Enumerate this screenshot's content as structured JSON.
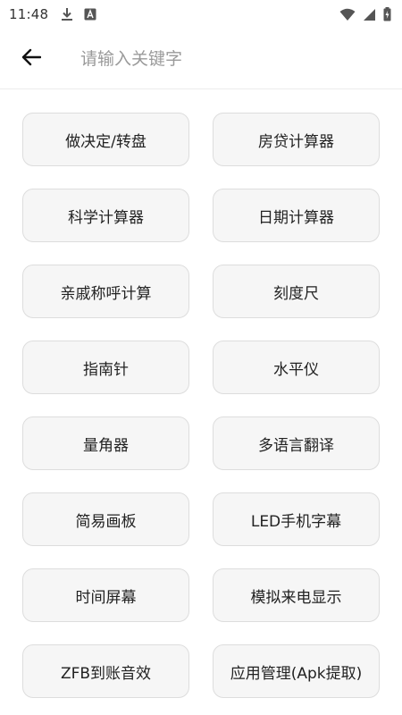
{
  "status_bar": {
    "time": "11:48",
    "icons_left": [
      "download-icon",
      "app-notification-icon"
    ],
    "icons_right": [
      "wifi-icon",
      "signal-icon",
      "battery-charging-icon"
    ]
  },
  "search": {
    "placeholder": "请输入关键字",
    "value": "",
    "back_icon": "arrow-left-icon"
  },
  "tools": [
    {
      "id": "decision-wheel",
      "label": "做决定/转盘"
    },
    {
      "id": "mortgage-calculator",
      "label": "房贷计算器"
    },
    {
      "id": "scientific-calculator",
      "label": "科学计算器"
    },
    {
      "id": "date-calculator",
      "label": "日期计算器"
    },
    {
      "id": "relative-title-calculator",
      "label": "亲戚称呼计算"
    },
    {
      "id": "ruler",
      "label": "刻度尺"
    },
    {
      "id": "compass",
      "label": "指南针"
    },
    {
      "id": "level",
      "label": "水平仪"
    },
    {
      "id": "protractor",
      "label": "量角器"
    },
    {
      "id": "translator",
      "label": "多语言翻译"
    },
    {
      "id": "sketchpad",
      "label": "简易画板"
    },
    {
      "id": "led-marquee",
      "label": "LED手机字幕"
    },
    {
      "id": "time-screen",
      "label": "时间屏幕"
    },
    {
      "id": "fake-call",
      "label": "模拟来电显示"
    },
    {
      "id": "zfb-sound",
      "label": "ZFB到账音效"
    },
    {
      "id": "apk-extract",
      "label": "应用管理(Apk提取)"
    }
  ],
  "colors": {
    "button_bg": "#f6f6f6",
    "button_border": "#dddddd",
    "placeholder": "#9a9a9a",
    "text": "#222222"
  }
}
